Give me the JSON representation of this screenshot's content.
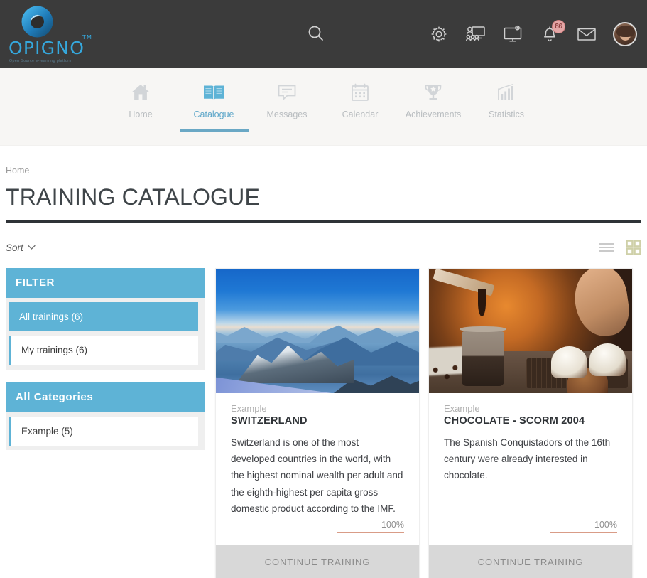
{
  "brand": {
    "name": "OPIGNO",
    "tm": "TM",
    "tagline": "Open Source e-learning platform"
  },
  "header": {
    "search_icon": "search-icon",
    "icons": [
      {
        "name": "gear-icon",
        "label": "Settings"
      },
      {
        "name": "training-icon",
        "label": "Trainings"
      },
      {
        "name": "screen-icon",
        "label": "Live meetings"
      },
      {
        "name": "bell-icon",
        "label": "Notifications",
        "badge": "86"
      },
      {
        "name": "envelope-icon",
        "label": "Messages"
      },
      {
        "name": "avatar",
        "label": "User account"
      }
    ]
  },
  "nav": {
    "items": [
      {
        "label": "Home",
        "icon": "home-icon",
        "active": false
      },
      {
        "label": "Catalogue",
        "icon": "book-icon",
        "active": true
      },
      {
        "label": "Messages",
        "icon": "speech-bubble-icon",
        "active": false
      },
      {
        "label": "Calendar",
        "icon": "calendar-icon",
        "active": false
      },
      {
        "label": "Achievements",
        "icon": "trophy-icon",
        "active": false
      },
      {
        "label": "Statistics",
        "icon": "bar-chart-icon",
        "active": false
      }
    ]
  },
  "breadcrumb": "Home",
  "page_title": "TRAINING CATALOGUE",
  "toolbar": {
    "sort_label": "Sort",
    "sort_chevron": "chevron-down-icon",
    "view_list": "list-view-icon",
    "view_grid": "grid-view-icon",
    "active_view": "grid"
  },
  "filter": {
    "title": "FILTER",
    "groups": [
      {
        "active_item": "All trainings (6)",
        "items": [
          "My trainings (6)"
        ]
      },
      {
        "active_item": "All Categories",
        "items": [
          "Example (5)"
        ]
      }
    ]
  },
  "cards": [
    {
      "image": "mountain-landscape",
      "category": "Example",
      "title": "SWITZERLAND",
      "description": "Switzerland is one of the most developed countries in the world, with the highest nominal wealth per adult and the eighth-highest per capita gross domestic product according to the IMF.",
      "progress_label": "100%",
      "progress_value": 100,
      "cta": "CONTINUE TRAINING"
    },
    {
      "image": "chocolate-baking",
      "category": "Example",
      "title": "CHOCOLATE - SCORM 2004",
      "description": "The Spanish Conquistadors of the 16th century were already interested in chocolate.",
      "progress_label": "100%",
      "progress_value": 100,
      "cta": "CONTINUE TRAINING"
    }
  ],
  "colors": {
    "header_bg": "#3b3b3b",
    "nav_bg": "#f7f6f4",
    "accent_blue": "#5eb3d6",
    "active_tab": "#6aa8c5",
    "progress": "#d99c87",
    "grid_active": "#cfd0a8",
    "cta_bg": "#d8d8d8"
  }
}
